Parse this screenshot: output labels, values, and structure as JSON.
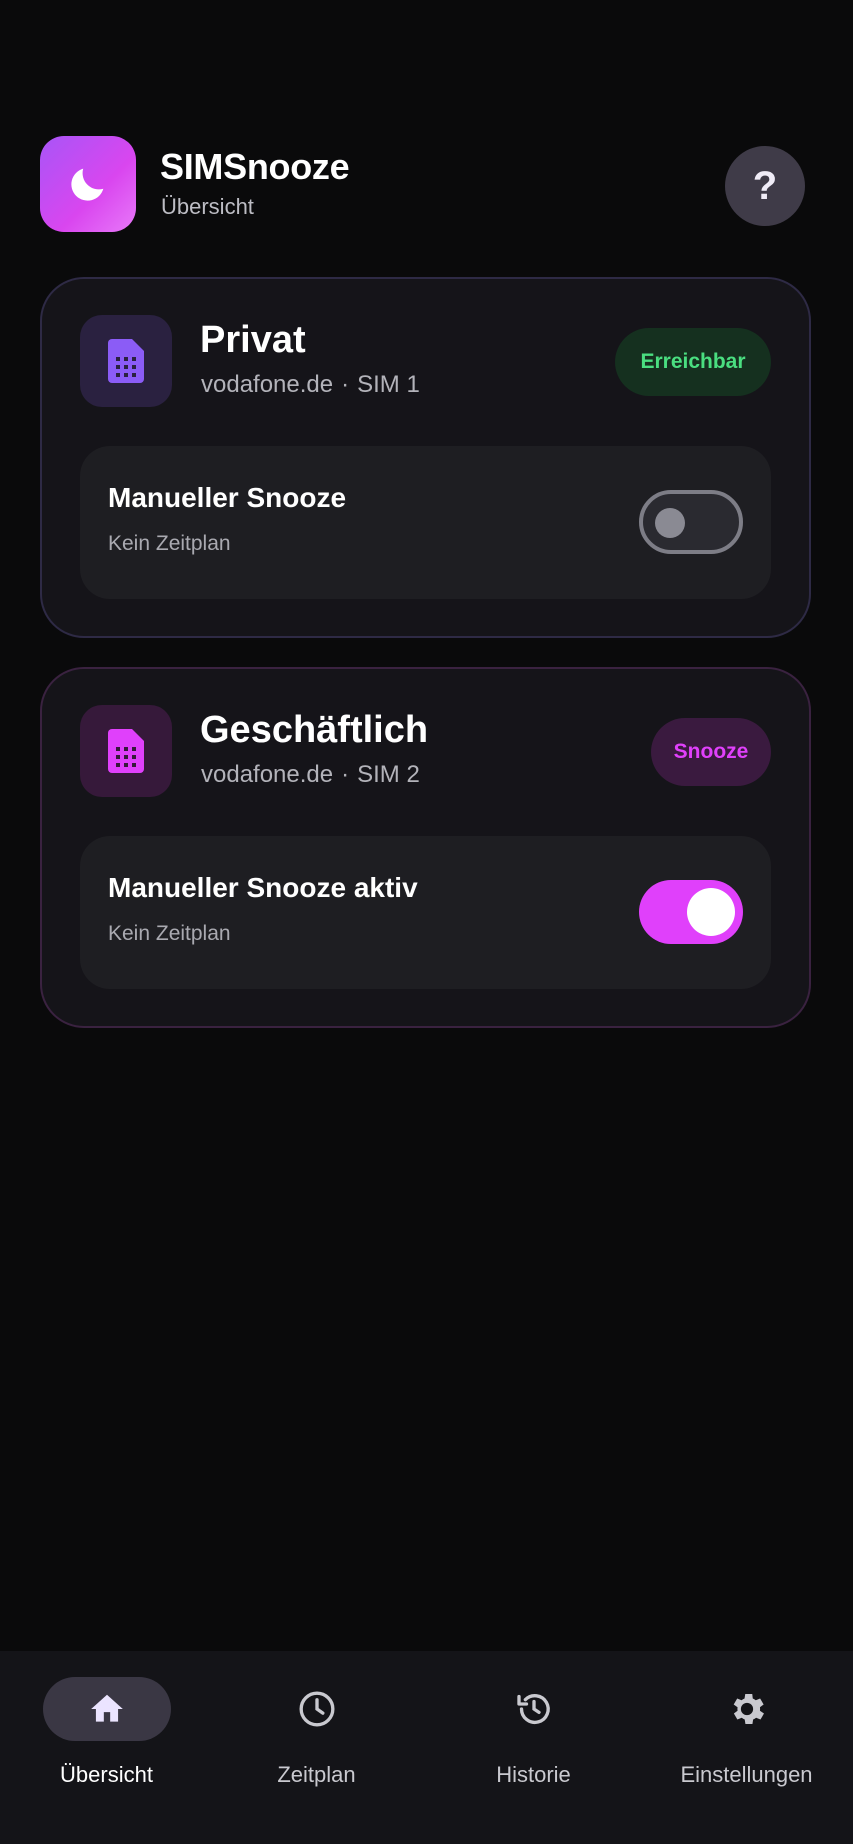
{
  "app": {
    "title": "SIMSnooze",
    "subtitle": "Übersicht",
    "help_label": "?"
  },
  "sims": [
    {
      "name": "Privat",
      "carrier": "vodafone.de",
      "separator": "·",
      "slot": "SIM 1",
      "status": "Erreichbar",
      "status_color": "#4ade80",
      "snooze_title": "Manueller Snooze",
      "snooze_sub": "Kein Zeitplan",
      "toggle_on": false,
      "accent": "#8b5cf6"
    },
    {
      "name": "Geschäftlich",
      "carrier": "vodafone.de",
      "separator": "·",
      "slot": "SIM 2",
      "status": "Snooze",
      "status_color": "#e040fb",
      "snooze_title": "Manueller Snooze aktiv",
      "snooze_sub": "Kein Zeitplan",
      "toggle_on": true,
      "accent": "#e040fb"
    }
  ],
  "nav": {
    "items": [
      {
        "label": "Übersicht",
        "icon": "home-icon",
        "active": true
      },
      {
        "label": "Zeitplan",
        "icon": "clock-icon",
        "active": false
      },
      {
        "label": "Historie",
        "icon": "history-icon",
        "active": false
      },
      {
        "label": "Einstellungen",
        "icon": "gear-icon",
        "active": false
      }
    ]
  }
}
